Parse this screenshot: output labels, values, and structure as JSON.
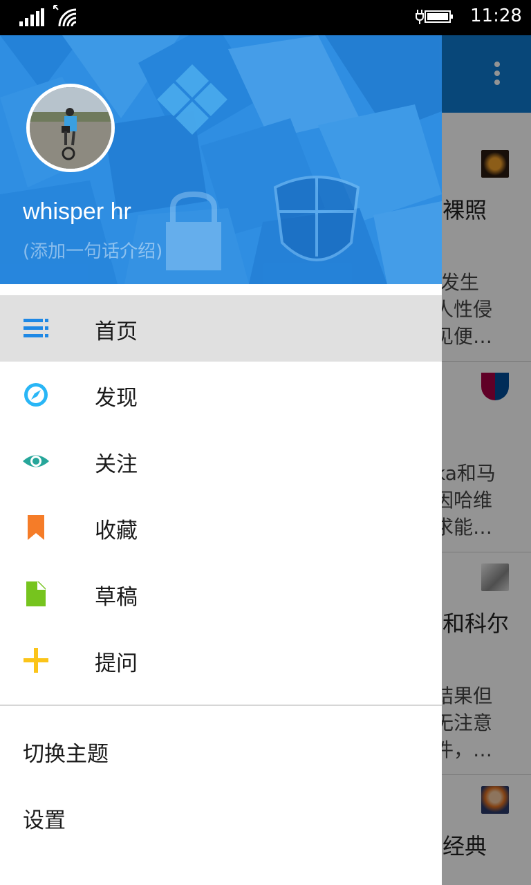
{
  "status_bar": {
    "time": "11:28",
    "signal_icon": "signal-bars-icon",
    "wifi_icon": "wifi-icon",
    "battery_icon": "battery-charging-icon"
  },
  "drawer": {
    "user": {
      "name": "whisper hr",
      "bio_placeholder": "(添加一句话介绍)"
    },
    "menu_items": [
      {
        "label": "首页",
        "icon": "home-list-icon",
        "color": "#1e88e5",
        "active": true
      },
      {
        "label": "发现",
        "icon": "compass-icon",
        "color": "#29b6f6",
        "active": false
      },
      {
        "label": "关注",
        "icon": "eye-icon",
        "color": "#26a69a",
        "active": false
      },
      {
        "label": "收藏",
        "icon": "bookmark-icon",
        "color": "#f57c28",
        "active": false
      },
      {
        "label": "草稿",
        "icon": "draft-document-icon",
        "color": "#76c41e",
        "active": false
      },
      {
        "label": "提问",
        "icon": "plus-icon",
        "color": "#fbc41a",
        "active": false
      }
    ],
    "bottom_items": {
      "theme": "切换主题",
      "settings": "设置"
    }
  },
  "background_feed": {
    "header_more_icon": "more-vertical-icon",
    "cards": [
      {
        "title": "裸照",
        "text": " 发生\n人性侵\n见便…"
      },
      {
        "title": "",
        "text": "ka和马\n因哈维\n求能…"
      },
      {
        "title": "和科尔",
        "text": "结果但\n无注意\n件，…"
      },
      {
        "title": "经典",
        "text": ""
      }
    ]
  },
  "colors": {
    "accent": "#1e88e5",
    "header_blue": "#2a8be0",
    "active_row": "#e0e0e0"
  }
}
